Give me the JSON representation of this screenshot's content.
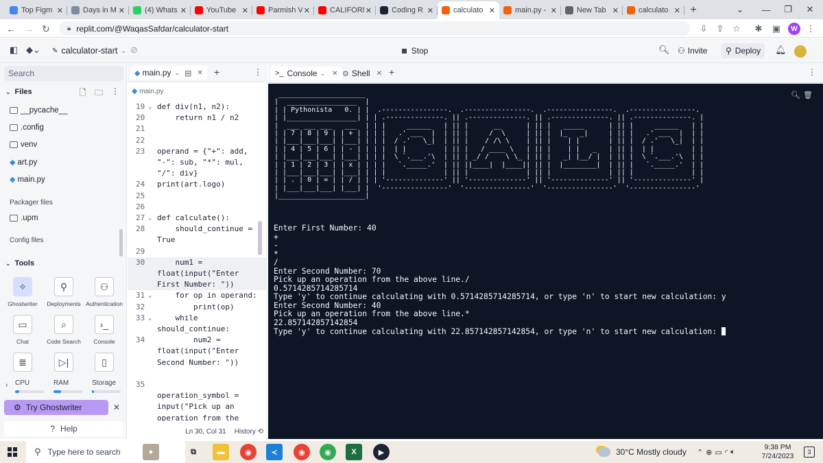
{
  "browser": {
    "tabs": [
      {
        "title": "Top Figm",
        "favicon_color": "#4285f4"
      },
      {
        "title": "Days in M",
        "favicon_color": "#7f8c9d"
      },
      {
        "title": "(4) Whats",
        "favicon_color": "#25d366"
      },
      {
        "title": "YouTube",
        "favicon_color": "#ff0000"
      },
      {
        "title": "Parmish V",
        "favicon_color": "#ff0000"
      },
      {
        "title": "CALIFORN",
        "favicon_color": "#ff0000"
      },
      {
        "title": "Coding R",
        "favicon_color": "#1c2333"
      },
      {
        "title": "calculato",
        "favicon_color": "#f26207",
        "active": true
      },
      {
        "title": "main.py -",
        "favicon_color": "#f26207"
      },
      {
        "title": "New Tab",
        "favicon_color": "#5f6368"
      },
      {
        "title": "calculato",
        "favicon_color": "#f26207"
      }
    ],
    "new_tab_glyph": "+",
    "url": "replit.com/@WaqasSafdar/calculator-start",
    "profile_initial": "W"
  },
  "replit": {
    "repl_name": "calculator-start",
    "stop_label": "Stop",
    "invite_label": "Invite",
    "deploy_label": "Deploy",
    "sidebar": {
      "search_placeholder": "Search",
      "files_header": "Files",
      "files": [
        {
          "name": "__pycache__",
          "kind": "folder"
        },
        {
          "name": ".config",
          "kind": "folder"
        },
        {
          "name": "venv",
          "kind": "folder"
        },
        {
          "name": "art.py",
          "kind": "python"
        },
        {
          "name": "main.py",
          "kind": "python"
        }
      ],
      "packager_label": "Packager files",
      "packager_files": [
        {
          "name": ".upm",
          "kind": "folder"
        }
      ],
      "config_label": "Config files",
      "tools_header": "Tools",
      "tools": [
        {
          "label": "Ghostwriter",
          "icon": "ghostwriter-icon"
        },
        {
          "label": "Deployments",
          "icon": "deployments-icon"
        },
        {
          "label": "Authentication",
          "icon": "authentication-icon"
        },
        {
          "label": "Chat",
          "icon": "chat-icon"
        },
        {
          "label": "Code Search",
          "icon": "search-icon"
        },
        {
          "label": "Console",
          "icon": "console-icon"
        },
        {
          "label": "",
          "icon": "database-icon"
        },
        {
          "label": "",
          "icon": "debugger-icon"
        },
        {
          "label": "",
          "icon": "tablet-icon"
        }
      ],
      "resources": [
        {
          "label": "CPU",
          "level": 0.15
        },
        {
          "label": "RAM",
          "level": 0.25
        },
        {
          "label": "Storage",
          "level": 0.08
        }
      ],
      "try_ghostwriter_label": "Try Ghostwriter",
      "help_label": "Help"
    },
    "editor": {
      "tab_label": "main.py",
      "breadcrumb": "main.py",
      "lines": [
        {
          "ln": "19",
          "fold": true,
          "code": "def div(n1, n2):"
        },
        {
          "ln": "20",
          "code": "    return n1 / n2"
        },
        {
          "ln": "21",
          "code": ""
        },
        {
          "ln": "22",
          "code": ""
        },
        {
          "ln": "23",
          "code": "operand = {\"+\": add,"
        },
        {
          "ln": "",
          "code": "\"-\": sub, \"*\": mul,"
        },
        {
          "ln": "",
          "code": "\"/\": div}"
        },
        {
          "ln": "24",
          "code": "print(art.logo)"
        },
        {
          "ln": "25",
          "code": ""
        },
        {
          "ln": "26",
          "code": ""
        },
        {
          "ln": "27",
          "fold": true,
          "code": "def calculate():"
        },
        {
          "ln": "28",
          "code": "    should_continue ="
        },
        {
          "ln": "",
          "code": "True"
        },
        {
          "ln": "29",
          "code": ""
        },
        {
          "ln": "30",
          "active": true,
          "code": "    num1 ="
        },
        {
          "ln": "",
          "active": true,
          "code": "float(input(\"Enter"
        },
        {
          "ln": "",
          "active": true,
          "code": "First Number: \"))"
        },
        {
          "ln": "31",
          "fold": true,
          "code": "    for op in operand:"
        },
        {
          "ln": "32",
          "code": "        print(op)"
        },
        {
          "ln": "33",
          "fold": true,
          "code": "    while"
        },
        {
          "ln": "",
          "code": "should_continue:"
        },
        {
          "ln": "34",
          "code": "        num2 ="
        },
        {
          "ln": "",
          "code": "float(input(\"Enter"
        },
        {
          "ln": "",
          "code": "Second Number: \"))"
        },
        {
          "ln": "",
          "code": ""
        },
        {
          "ln": "35",
          "code": ""
        },
        {
          "ln": "",
          "code": "operation_symbol ="
        },
        {
          "ln": "",
          "code": "input(\"Pick up an"
        },
        {
          "ln": "",
          "code": "operation from the"
        }
      ],
      "cursor_position": "Ln 30, Col 31",
      "history_label": "History"
    },
    "console": {
      "tab_console": "Console",
      "tab_shell": "Shell",
      "ascii_logo": " _____________________\n|  _________________  |\n| | Pythonista   0. | |  .----------------.  .----------------.  .----------------.  .----------------.\n| |_________________| | | .--------------. || .--------------. || .--------------. || .--------------. |\n|  ___ ___ ___   ___  | | |     ______   | || |      __      | || |   _____      | || |     ______   | |\n| | 7 | 8 | 9 | | + | | | |   .' ___  |  | || |     /  \\     | || |  |_   _|     | || |   .' ___  |  | |\n| |___|___|___| |___| | | |  / .'   \\_|  | || |    / /\\ \\    | || |    | |       | || |  / .'   \\_|  | |\n| | 4 | 5 | 6 | | - | | | |  | |         | || |   / ____ \\   | || |    | |   _   | || |  | |         | |\n| |___|___|___| |___| | | |  \\ `.___.'\\  | || | _/ /    \\ \\_ | || |   _| |__/ |  | || |  \\ `.___.'\\  | |\n| | 1 | 2 | 3 | | x | | | |   `._____.'  | || ||____|  |____|| || |  |________|  | || |   `._____.'  | |\n| |___|___|___| |___| | | |              | || |              | || |              | || |              | |\n| | . | 0 | = | | / | | | '--------------' || '--------------' || '--------------' || '--------------' |\n| |___|___|___| |___| |  '----------------'  '----------------'  '----------------'  '----------------'\n|_____________________|",
      "output": [
        "Enter First Number: 40",
        "+",
        "-",
        "*",
        "/",
        "Enter Second Number: 70",
        "Pick up an operation from the above line./",
        "0.5714285714285714",
        "Type 'y' to continue calculating with 0.5714285714285714, or type 'n' to start new calculation: y",
        "Enter Second Number: 40",
        "Pick up an operation from the above line.*",
        "22.857142857142854",
        "Type 'y' to continue calculating with 22.857142857142854, or type 'n' to start new calculation: "
      ]
    }
  },
  "taskbar": {
    "search_placeholder": "Type here to search",
    "weather": "30°C  Mostly cloudy",
    "time": "9:38 PM",
    "date": "7/24/2023",
    "notification_count": "3"
  }
}
